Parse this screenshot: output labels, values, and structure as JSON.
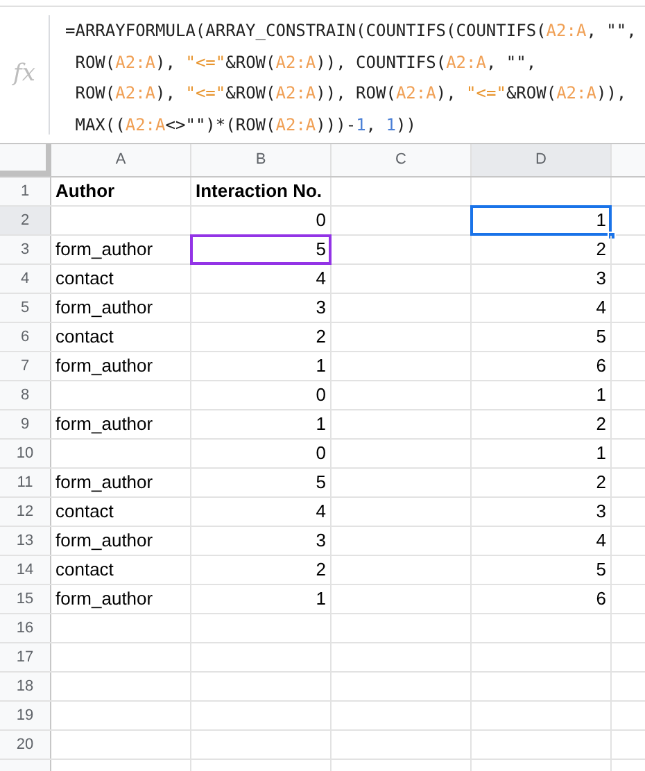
{
  "formula_bar": {
    "icon_label": "fx",
    "lines": [
      [
        {
          "kind": "plain",
          "text": "=ARRAYFORMULA(ARRAY_CONSTRAIN(COUNTIFS(COUNTIFS("
        },
        {
          "kind": "range",
          "text": "A2:A"
        },
        {
          "kind": "plain",
          "text": ", \"\","
        }
      ],
      [
        {
          "kind": "plain",
          "text": " ROW("
        },
        {
          "kind": "range",
          "text": "A2:A"
        },
        {
          "kind": "plain",
          "text": "), "
        },
        {
          "kind": "string",
          "text": "\"<=\""
        },
        {
          "kind": "plain",
          "text": "&ROW("
        },
        {
          "kind": "range",
          "text": "A2:A"
        },
        {
          "kind": "plain",
          "text": ")), COUNTIFS("
        },
        {
          "kind": "range",
          "text": "A2:A"
        },
        {
          "kind": "plain",
          "text": ", \"\","
        }
      ],
      [
        {
          "kind": "plain",
          "text": " ROW("
        },
        {
          "kind": "range",
          "text": "A2:A"
        },
        {
          "kind": "plain",
          "text": "), "
        },
        {
          "kind": "string",
          "text": "\"<=\""
        },
        {
          "kind": "plain",
          "text": "&ROW("
        },
        {
          "kind": "range",
          "text": "A2:A"
        },
        {
          "kind": "plain",
          "text": ")), ROW("
        },
        {
          "kind": "range",
          "text": "A2:A"
        },
        {
          "kind": "plain",
          "text": "), "
        },
        {
          "kind": "string",
          "text": "\"<=\""
        },
        {
          "kind": "plain",
          "text": "&ROW("
        },
        {
          "kind": "range",
          "text": "A2:A"
        },
        {
          "kind": "plain",
          "text": ")),"
        }
      ],
      [
        {
          "kind": "plain",
          "text": " MAX(("
        },
        {
          "kind": "range",
          "text": "A2:A"
        },
        {
          "kind": "plain",
          "text": "<>\"\")*(ROW("
        },
        {
          "kind": "range",
          "text": "A2:A"
        },
        {
          "kind": "plain",
          "text": ")))-"
        },
        {
          "kind": "number",
          "text": "1"
        },
        {
          "kind": "plain",
          "text": ", "
        },
        {
          "kind": "number",
          "text": "1"
        },
        {
          "kind": "plain",
          "text": "))"
        }
      ]
    ]
  },
  "columns": [
    {
      "label": "A",
      "selected": false
    },
    {
      "label": "B",
      "selected": false
    },
    {
      "label": "C",
      "selected": false
    },
    {
      "label": "D",
      "selected": true
    }
  ],
  "rows": [
    {
      "number": "1",
      "selected": false,
      "cells": [
        {
          "kind": "header",
          "text": "Author",
          "selected": false,
          "referenced": false
        },
        {
          "kind": "header",
          "text": "Interaction No.",
          "selected": false,
          "referenced": false
        },
        {
          "kind": "empty"
        },
        {
          "kind": "empty"
        }
      ]
    },
    {
      "number": "2",
      "selected": true,
      "cells": [
        {
          "kind": "empty"
        },
        {
          "kind": "number",
          "text": "0",
          "selected": false,
          "referenced": false
        },
        {
          "kind": "empty"
        },
        {
          "kind": "number",
          "text": "1",
          "selected": true,
          "referenced": false
        }
      ]
    },
    {
      "number": "3",
      "selected": false,
      "cells": [
        {
          "kind": "text",
          "text": "form_author",
          "selected": false,
          "referenced": false
        },
        {
          "kind": "number",
          "text": "5",
          "selected": false,
          "referenced": true
        },
        {
          "kind": "empty"
        },
        {
          "kind": "number",
          "text": "2",
          "selected": false,
          "referenced": false
        }
      ]
    },
    {
      "number": "4",
      "selected": false,
      "cells": [
        {
          "kind": "text",
          "text": "contact",
          "selected": false,
          "referenced": false
        },
        {
          "kind": "number",
          "text": "4",
          "selected": false,
          "referenced": false
        },
        {
          "kind": "empty"
        },
        {
          "kind": "number",
          "text": "3",
          "selected": false,
          "referenced": false
        }
      ]
    },
    {
      "number": "5",
      "selected": false,
      "cells": [
        {
          "kind": "text",
          "text": "form_author",
          "selected": false,
          "referenced": false
        },
        {
          "kind": "number",
          "text": "3",
          "selected": false,
          "referenced": false
        },
        {
          "kind": "empty"
        },
        {
          "kind": "number",
          "text": "4",
          "selected": false,
          "referenced": false
        }
      ]
    },
    {
      "number": "6",
      "selected": false,
      "cells": [
        {
          "kind": "text",
          "text": "contact",
          "selected": false,
          "referenced": false
        },
        {
          "kind": "number",
          "text": "2",
          "selected": false,
          "referenced": false
        },
        {
          "kind": "empty"
        },
        {
          "kind": "number",
          "text": "5",
          "selected": false,
          "referenced": false
        }
      ]
    },
    {
      "number": "7",
      "selected": false,
      "cells": [
        {
          "kind": "text",
          "text": "form_author",
          "selected": false,
          "referenced": false
        },
        {
          "kind": "number",
          "text": "1",
          "selected": false,
          "referenced": false
        },
        {
          "kind": "empty"
        },
        {
          "kind": "number",
          "text": "6",
          "selected": false,
          "referenced": false
        }
      ]
    },
    {
      "number": "8",
      "selected": false,
      "cells": [
        {
          "kind": "empty"
        },
        {
          "kind": "number",
          "text": "0",
          "selected": false,
          "referenced": false
        },
        {
          "kind": "empty"
        },
        {
          "kind": "number",
          "text": "1",
          "selected": false,
          "referenced": false
        }
      ]
    },
    {
      "number": "9",
      "selected": false,
      "cells": [
        {
          "kind": "text",
          "text": "form_author",
          "selected": false,
          "referenced": false
        },
        {
          "kind": "number",
          "text": "1",
          "selected": false,
          "referenced": false
        },
        {
          "kind": "empty"
        },
        {
          "kind": "number",
          "text": "2",
          "selected": false,
          "referenced": false
        }
      ]
    },
    {
      "number": "10",
      "selected": false,
      "cells": [
        {
          "kind": "empty"
        },
        {
          "kind": "number",
          "text": "0",
          "selected": false,
          "referenced": false
        },
        {
          "kind": "empty"
        },
        {
          "kind": "number",
          "text": "1",
          "selected": false,
          "referenced": false
        }
      ]
    },
    {
      "number": "11",
      "selected": false,
      "cells": [
        {
          "kind": "text",
          "text": "form_author",
          "selected": false,
          "referenced": false
        },
        {
          "kind": "number",
          "text": "5",
          "selected": false,
          "referenced": false
        },
        {
          "kind": "empty"
        },
        {
          "kind": "number",
          "text": "2",
          "selected": false,
          "referenced": false
        }
      ]
    },
    {
      "number": "12",
      "selected": false,
      "cells": [
        {
          "kind": "text",
          "text": "contact",
          "selected": false,
          "referenced": false
        },
        {
          "kind": "number",
          "text": "4",
          "selected": false,
          "referenced": false
        },
        {
          "kind": "empty"
        },
        {
          "kind": "number",
          "text": "3",
          "selected": false,
          "referenced": false
        }
      ]
    },
    {
      "number": "13",
      "selected": false,
      "cells": [
        {
          "kind": "text",
          "text": "form_author",
          "selected": false,
          "referenced": false
        },
        {
          "kind": "number",
          "text": "3",
          "selected": false,
          "referenced": false
        },
        {
          "kind": "empty"
        },
        {
          "kind": "number",
          "text": "4",
          "selected": false,
          "referenced": false
        }
      ]
    },
    {
      "number": "14",
      "selected": false,
      "cells": [
        {
          "kind": "text",
          "text": "contact",
          "selected": false,
          "referenced": false
        },
        {
          "kind": "number",
          "text": "2",
          "selected": false,
          "referenced": false
        },
        {
          "kind": "empty"
        },
        {
          "kind": "number",
          "text": "5",
          "selected": false,
          "referenced": false
        }
      ]
    },
    {
      "number": "15",
      "selected": false,
      "cells": [
        {
          "kind": "text",
          "text": "form_author",
          "selected": false,
          "referenced": false
        },
        {
          "kind": "number",
          "text": "1",
          "selected": false,
          "referenced": false
        },
        {
          "kind": "empty"
        },
        {
          "kind": "number",
          "text": "6",
          "selected": false,
          "referenced": false
        }
      ]
    },
    {
      "number": "16",
      "selected": false
    },
    {
      "number": "17",
      "selected": false
    },
    {
      "number": "18",
      "selected": false
    },
    {
      "number": "19",
      "selected": false
    },
    {
      "number": "20",
      "selected": false
    }
  ]
}
